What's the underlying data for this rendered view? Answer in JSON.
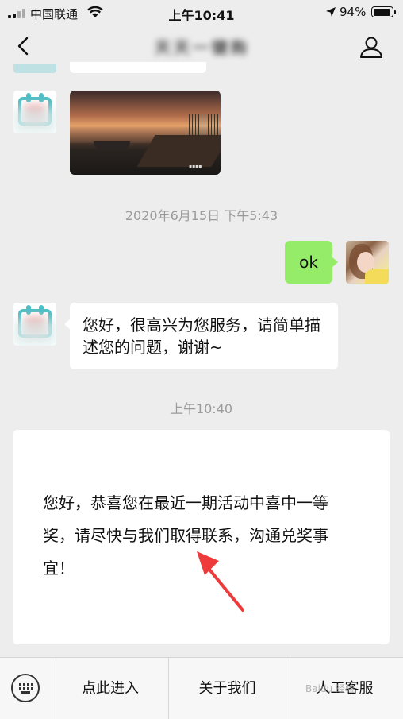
{
  "status_bar": {
    "carrier": "中国联通",
    "time": "上午10:41",
    "battery": "94%",
    "battery_level": 0.94
  },
  "nav": {
    "title": "天天一键购"
  },
  "messages": {
    "timestamp_1": "2020年6月15日 下午5:43",
    "ok_text": "ok",
    "greeting": "您好，很高兴为您服务，请简单描述您的问题，谢谢~",
    "timestamp_2": "上午10:40",
    "card_text": "您好，恭喜您在最近一期活动中喜中一等奖，请尽快与我们取得联系，沟通兑奖事宜！"
  },
  "menu": {
    "item1": "点此进入",
    "item2": "关于我们",
    "item3": "人工客服"
  },
  "watermark": "Baidu 经验",
  "colors": {
    "sent_bubble": "#95ec69",
    "background": "#ededed",
    "annotation_arrow": "#ee3a3a"
  }
}
